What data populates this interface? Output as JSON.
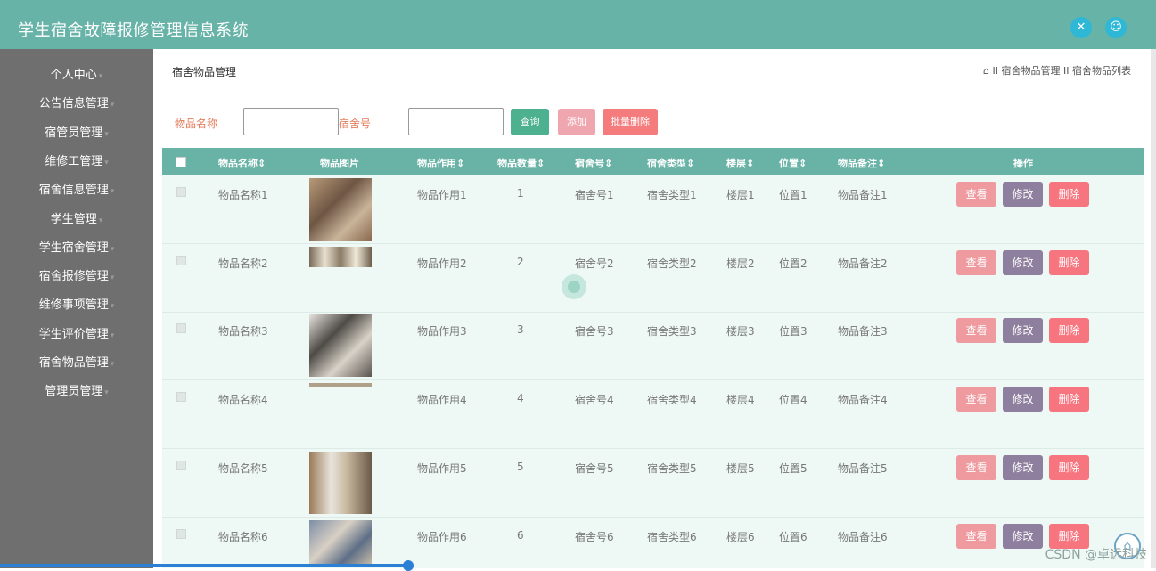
{
  "header": {
    "title": "学生宿舍故障报修管理信息系统"
  },
  "sidebar": {
    "items": [
      {
        "label": "个人中心"
      },
      {
        "label": "公告信息管理"
      },
      {
        "label": "宿管员管理"
      },
      {
        "label": "维修工管理"
      },
      {
        "label": "宿舍信息管理"
      },
      {
        "label": "学生管理"
      },
      {
        "label": "学生宿舍管理"
      },
      {
        "label": "宿舍报修管理"
      },
      {
        "label": "维修事项管理"
      },
      {
        "label": "学生评价管理"
      },
      {
        "label": "宿舍物品管理"
      },
      {
        "label": "管理员管理"
      }
    ]
  },
  "page": {
    "title": "宿舍物品管理",
    "breadcrumb": [
      "宿舍物品管理",
      "宿舍物品列表"
    ],
    "breadcrumb_sep": "II"
  },
  "filters": {
    "name_label": "物品名称",
    "name_value": "",
    "room_label": "宿舍号",
    "room_value": "",
    "search_label": "查询",
    "add_label": "添加",
    "batch_delete_label": "批量删除"
  },
  "table": {
    "headers": {
      "name": "物品名称",
      "image": "物品图片",
      "usage": "物品作用",
      "qty": "物品数量",
      "room": "宿舍号",
      "roomtype": "宿舍类型",
      "floor": "楼层",
      "position": "位置",
      "remark": "物品备注",
      "actions": "操作"
    },
    "sort_glyph": "⇕",
    "rows": [
      {
        "name": "物品名称1",
        "usage": "物品作用1",
        "qty": "1",
        "room": "宿舍号1",
        "roomtype": "宿舍类型1",
        "floor": "楼层1",
        "position": "位置1",
        "remark": "物品备注1"
      },
      {
        "name": "物品名称2",
        "usage": "物品作用2",
        "qty": "2",
        "room": "宿舍号2",
        "roomtype": "宿舍类型2",
        "floor": "楼层2",
        "position": "位置2",
        "remark": "物品备注2"
      },
      {
        "name": "物品名称3",
        "usage": "物品作用3",
        "qty": "3",
        "room": "宿舍号3",
        "roomtype": "宿舍类型3",
        "floor": "楼层3",
        "position": "位置3",
        "remark": "物品备注3"
      },
      {
        "name": "物品名称4",
        "usage": "物品作用4",
        "qty": "4",
        "room": "宿舍号4",
        "roomtype": "宿舍类型4",
        "floor": "楼层4",
        "position": "位置4",
        "remark": "物品备注4"
      },
      {
        "name": "物品名称5",
        "usage": "物品作用5",
        "qty": "5",
        "room": "宿舍号5",
        "roomtype": "宿舍类型5",
        "floor": "楼层5",
        "position": "位置5",
        "remark": "物品备注5"
      },
      {
        "name": "物品名称6",
        "usage": "物品作用6",
        "qty": "6",
        "room": "宿舍号6",
        "roomtype": "宿舍类型6",
        "floor": "楼层6",
        "position": "位置6",
        "remark": "物品备注6"
      }
    ],
    "action_labels": {
      "view": "查看",
      "edit": "修改",
      "delete": "删除"
    }
  },
  "watermark": "CSDN @卓远科技",
  "colors": {
    "header": "#68b3a8",
    "sidebar": "#6f6f6f",
    "search_btn": "#4db08e",
    "add_btn": "#f0a6ae",
    "batch_btn": "#f47c7c",
    "view_btn": "#ee9a9e",
    "edit_btn": "#8f7f9e",
    "delete_btn": "#f6757f"
  }
}
